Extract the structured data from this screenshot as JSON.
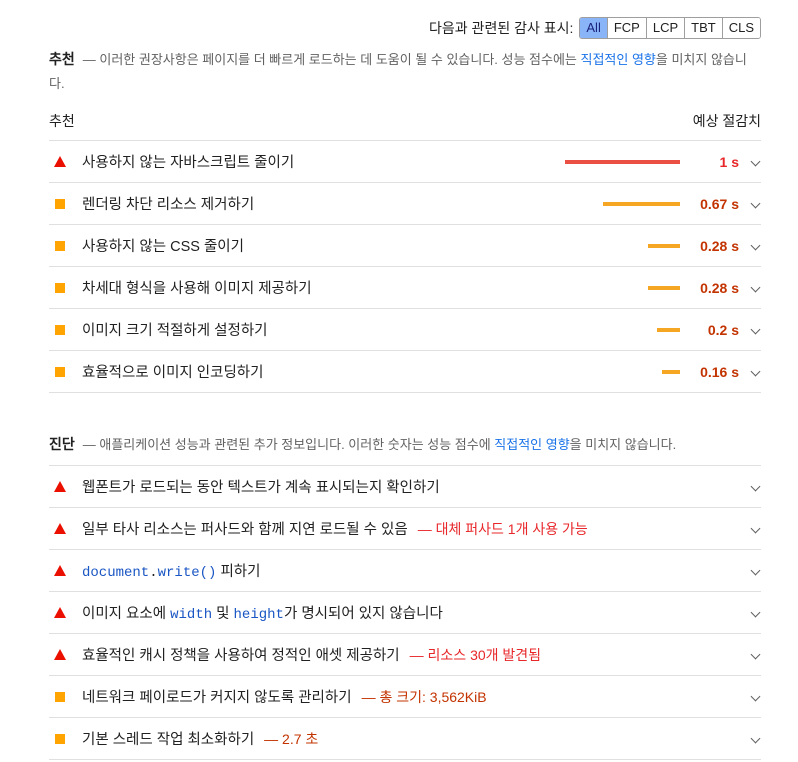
{
  "filter": {
    "label": "다음과 관련된 감사 표시:",
    "chips": [
      "All",
      "FCP",
      "LCP",
      "TBT",
      "CLS"
    ],
    "active": "All"
  },
  "opportunities": {
    "title": "추천",
    "desc_pre": "— 이러한 권장사항은 페이지를 더 빠르게 로드하는 데 도움이 될 수 있습니다. 성능 점수에는 ",
    "desc_link": "직접적인 영향",
    "desc_post": "을 미치지 않습니다.",
    "col_left": "추천",
    "col_right": "예상 절감치",
    "items": [
      {
        "icon": "fail",
        "title": "사용하지 않는 자바스크립트 줄이기",
        "saving": "1 s",
        "bar_fraction": 1.0
      },
      {
        "icon": "average",
        "title": "렌더링 차단 리소스 제거하기",
        "saving": "0.67 s",
        "bar_fraction": 0.67
      },
      {
        "icon": "average",
        "title": "사용하지 않는 CSS 줄이기",
        "saving": "0.28 s",
        "bar_fraction": 0.28
      },
      {
        "icon": "average",
        "title": "차세대 형식을 사용해 이미지 제공하기",
        "saving": "0.28 s",
        "bar_fraction": 0.28
      },
      {
        "icon": "average",
        "title": "이미지 크기 적절하게 설정하기",
        "saving": "0.2 s",
        "bar_fraction": 0.2
      },
      {
        "icon": "average",
        "title": "효율적으로 이미지 인코딩하기",
        "saving": "0.16 s",
        "bar_fraction": 0.16
      }
    ]
  },
  "diagnostics": {
    "title": "진단",
    "desc_pre": "— 애플리케이션 성능과 관련된 추가 정보입니다. 이러한 숫자는 성능 점수에 ",
    "desc_link": "직접적인 영향",
    "desc_post": "을 미치지 않습니다.",
    "items": [
      {
        "icon": "fail",
        "title": "웹폰트가 로드되는 동안 텍스트가 계속 표시되는지 확인하기"
      },
      {
        "icon": "fail",
        "title": "일부 타사 리소스는 퍼사드와 함께 지연 로드될 수 있음",
        "extra": "— 대체 퍼사드 1개 사용 가능"
      },
      {
        "icon": "fail",
        "code1": "document",
        "code_dot": ".",
        "code2": "write()",
        "title_post": " 피하기"
      },
      {
        "icon": "fail",
        "title_pre": "이미지 요소에 ",
        "code_a": "width",
        "title_mid": " 및 ",
        "code_b": "height",
        "title_post": "가 명시되어 있지 않습니다"
      },
      {
        "icon": "fail",
        "title": "효율적인 캐시 정책을 사용하여 정적인 애셋 제공하기",
        "extra": "— 리소스 30개 발견됨"
      },
      {
        "icon": "average",
        "title": "네트워크 페이로드가 커지지 않도록 관리하기",
        "extra": "— 총 크기: 3,562KiB"
      },
      {
        "icon": "average",
        "title": "기본 스레드 작업 최소화하기",
        "extra": "— 2.7 초"
      }
    ]
  },
  "colors": {
    "fail": "#eb0f00",
    "average": "#ffa400",
    "accent": "#1a73e8"
  }
}
